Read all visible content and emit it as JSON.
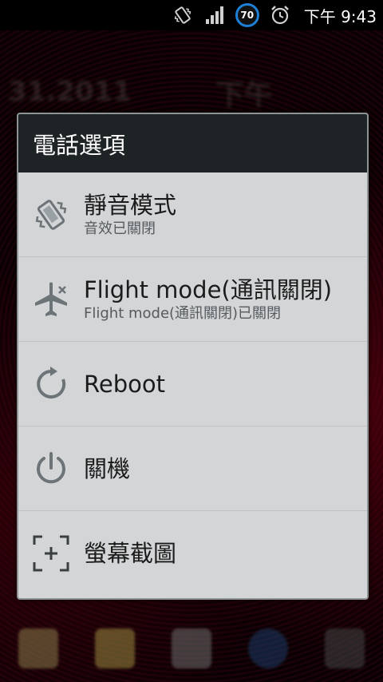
{
  "status_bar": {
    "battery_level": "70",
    "time": "下午 9:43",
    "icons": [
      "vibrate-icon",
      "signal-icon",
      "battery-icon",
      "alarm-icon"
    ]
  },
  "background": {
    "date_text": "31.2011",
    "ampm_text": "下午"
  },
  "dialog": {
    "title": "電話選項",
    "options": [
      {
        "title": "靜音模式",
        "subtitle": "音效已關閉",
        "icon": "vibrate-icon"
      },
      {
        "title": "Flight mode(通訊關閉)",
        "subtitle": "Flight mode(通訊關閉)已關閉",
        "icon": "airplane-off-icon"
      },
      {
        "title": "Reboot",
        "subtitle": "",
        "icon": "reboot-icon"
      },
      {
        "title": "關機",
        "subtitle": "",
        "icon": "power-icon"
      },
      {
        "title": "螢幕截圖",
        "subtitle": "",
        "icon": "screenshot-icon"
      }
    ]
  },
  "colors": {
    "dialog_header": "#1e2326",
    "dialog_body": "#d3d5d7",
    "battery_ring": "#1f7fd6"
  }
}
